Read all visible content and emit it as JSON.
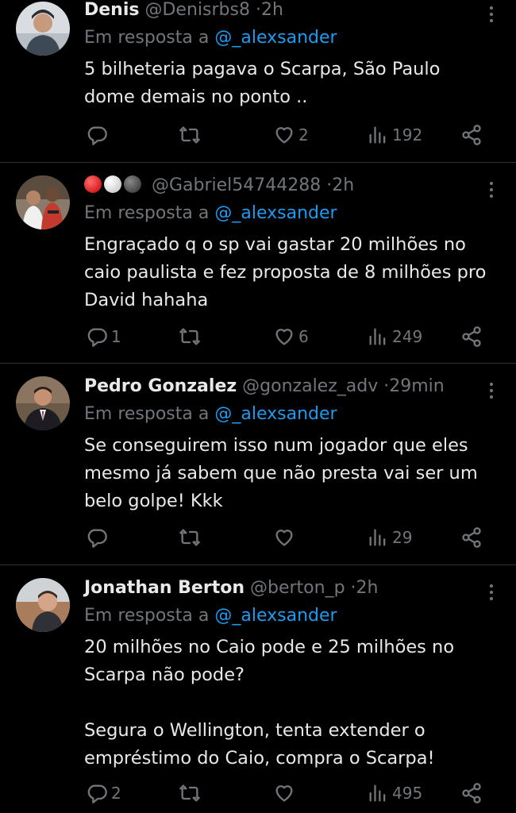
{
  "reply_prefix": "Em resposta a",
  "colors": {
    "background": "#000000",
    "text": "#e7e9ea",
    "muted": "#71767b",
    "link": "#1d9bf0"
  },
  "tweets": [
    {
      "name": "Denis",
      "handle": "@Denisrbs8",
      "time": "2h",
      "mention": "@_alexsander",
      "text": "5 bilheteria pagava o Scarpa, São Paulo\ndome demais no ponto ..",
      "replies": "",
      "likes": "2",
      "views": "192"
    },
    {
      "name": "",
      "name_emoji": [
        "red-circle",
        "white-circle",
        "black-circle"
      ],
      "handle": "@Gabriel54744288",
      "time": "2h",
      "mention": "@_alexsander",
      "text": "Engraçado q o sp vai gastar 20 milhões no\ncaio paulista e fez proposta de 8 milhões pro\nDavid hahaha",
      "replies": "1",
      "likes": "6",
      "views": "249"
    },
    {
      "name": "Pedro Gonzalez",
      "handle": "@gonzalez_adv",
      "time": "29min",
      "mention": "@_alexsander",
      "text": "Se conseguirem isso num jogador que eles\nmesmo já sabem que não presta vai ser um\nbelo golpe! Kkk",
      "replies": "",
      "likes": "",
      "views": "29"
    },
    {
      "name": "Jonathan Berton",
      "handle": "@berton_p",
      "time": "2h",
      "mention": "@_alexsander",
      "text": "20 milhões no Caio pode e 25 milhões no\nScarpa não pode?\n\nSegura o Wellington, tenta extender o\nempréstimo do Caio, compra o Scarpa!",
      "replies": "2",
      "likes": "",
      "views": "495"
    }
  ]
}
